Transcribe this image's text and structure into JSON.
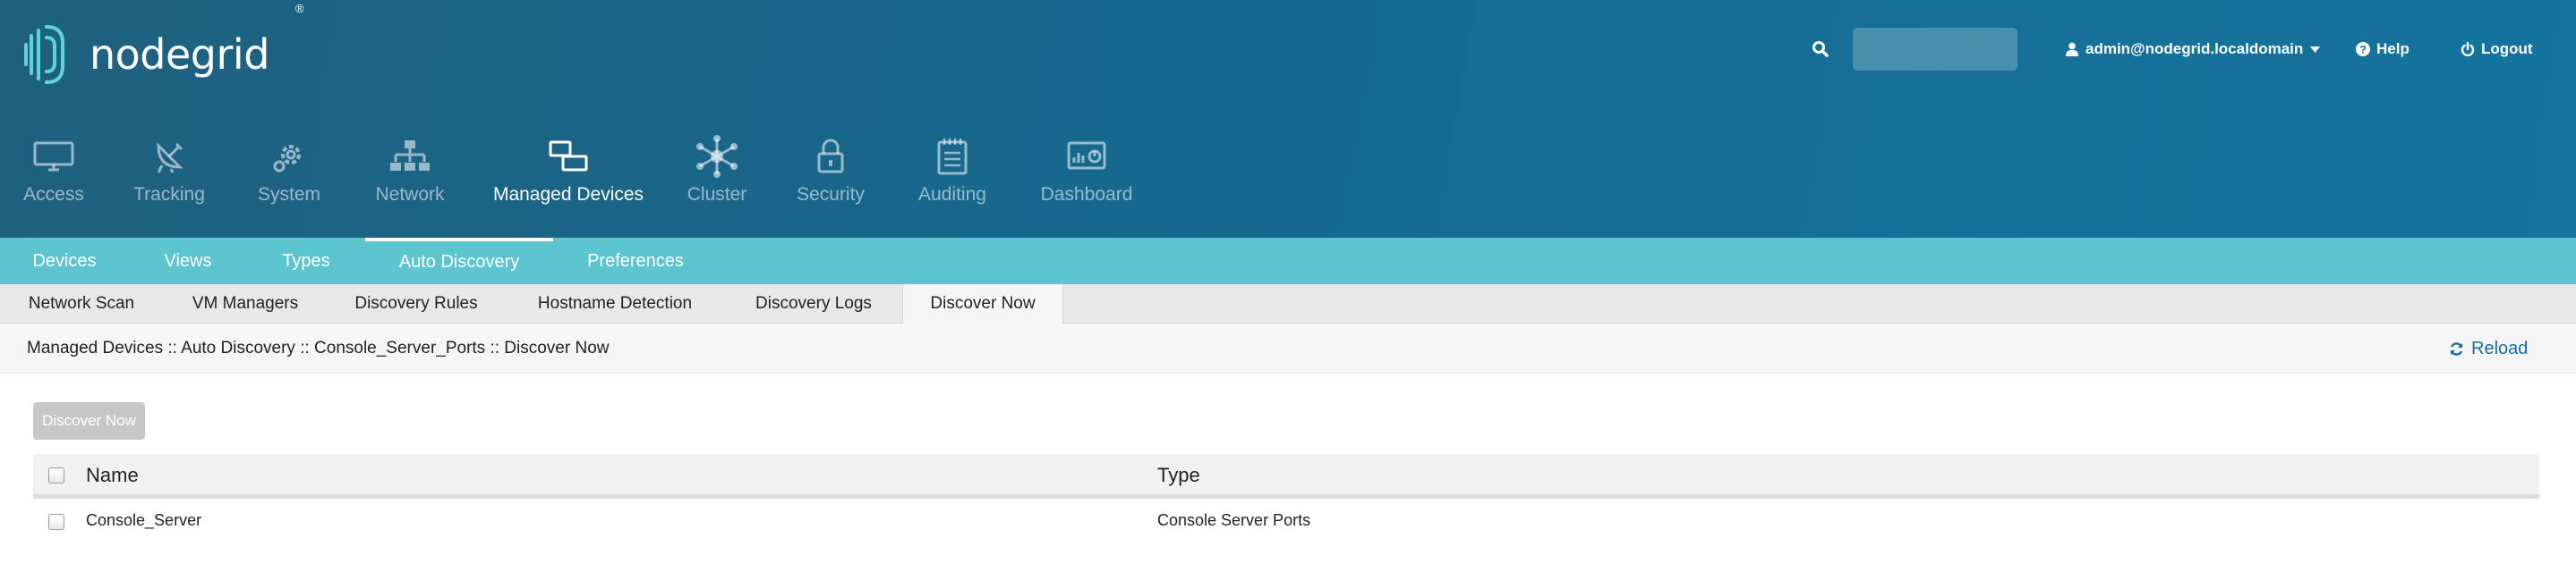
{
  "header": {
    "logo_text": "nodegrid",
    "logo_mark": "®",
    "search": {
      "value": "",
      "placeholder": ""
    },
    "user_menu": "admin@nodegrid.localdomain",
    "help": "Help",
    "logout": "Logout"
  },
  "main_nav": [
    {
      "label": "Access",
      "icon": "monitor-icon"
    },
    {
      "label": "Tracking",
      "icon": "satellite-dish-icon"
    },
    {
      "label": "System",
      "icon": "gear-icon"
    },
    {
      "label": "Network",
      "icon": "network-tree-icon"
    },
    {
      "label": "Managed Devices",
      "icon": "devices-icon",
      "active": true
    },
    {
      "label": "Cluster",
      "icon": "cluster-hub-icon"
    },
    {
      "label": "Security",
      "icon": "padlock-icon"
    },
    {
      "label": "Auditing",
      "icon": "notepad-icon"
    },
    {
      "label": "Dashboard",
      "icon": "dashboard-chart-icon"
    }
  ],
  "sub_nav": [
    {
      "label": "Devices"
    },
    {
      "label": "Views"
    },
    {
      "label": "Types"
    },
    {
      "label": "Auto Discovery",
      "active": true
    },
    {
      "label": "Preferences"
    }
  ],
  "tabs": [
    {
      "label": "Network Scan"
    },
    {
      "label": "VM Managers"
    },
    {
      "label": "Discovery Rules"
    },
    {
      "label": "Hostname Detection"
    },
    {
      "label": "Discovery Logs"
    },
    {
      "label": "Discover Now",
      "active": true
    }
  ],
  "breadcrumb": "Managed Devices :: Auto Discovery :: Console_Server_Ports :: Discover Now",
  "reload_label": "Reload",
  "discover_button": "Discover Now",
  "table": {
    "columns": [
      "Name",
      "Type"
    ],
    "rows": [
      {
        "name": "Console_Server",
        "type": "Console Server Ports"
      }
    ]
  },
  "colors": {
    "header_bg": "#16698f",
    "subnav_bg": "#5cc5cd",
    "link": "#1a6f9c",
    "button_disabled": "#c7c7c7"
  }
}
